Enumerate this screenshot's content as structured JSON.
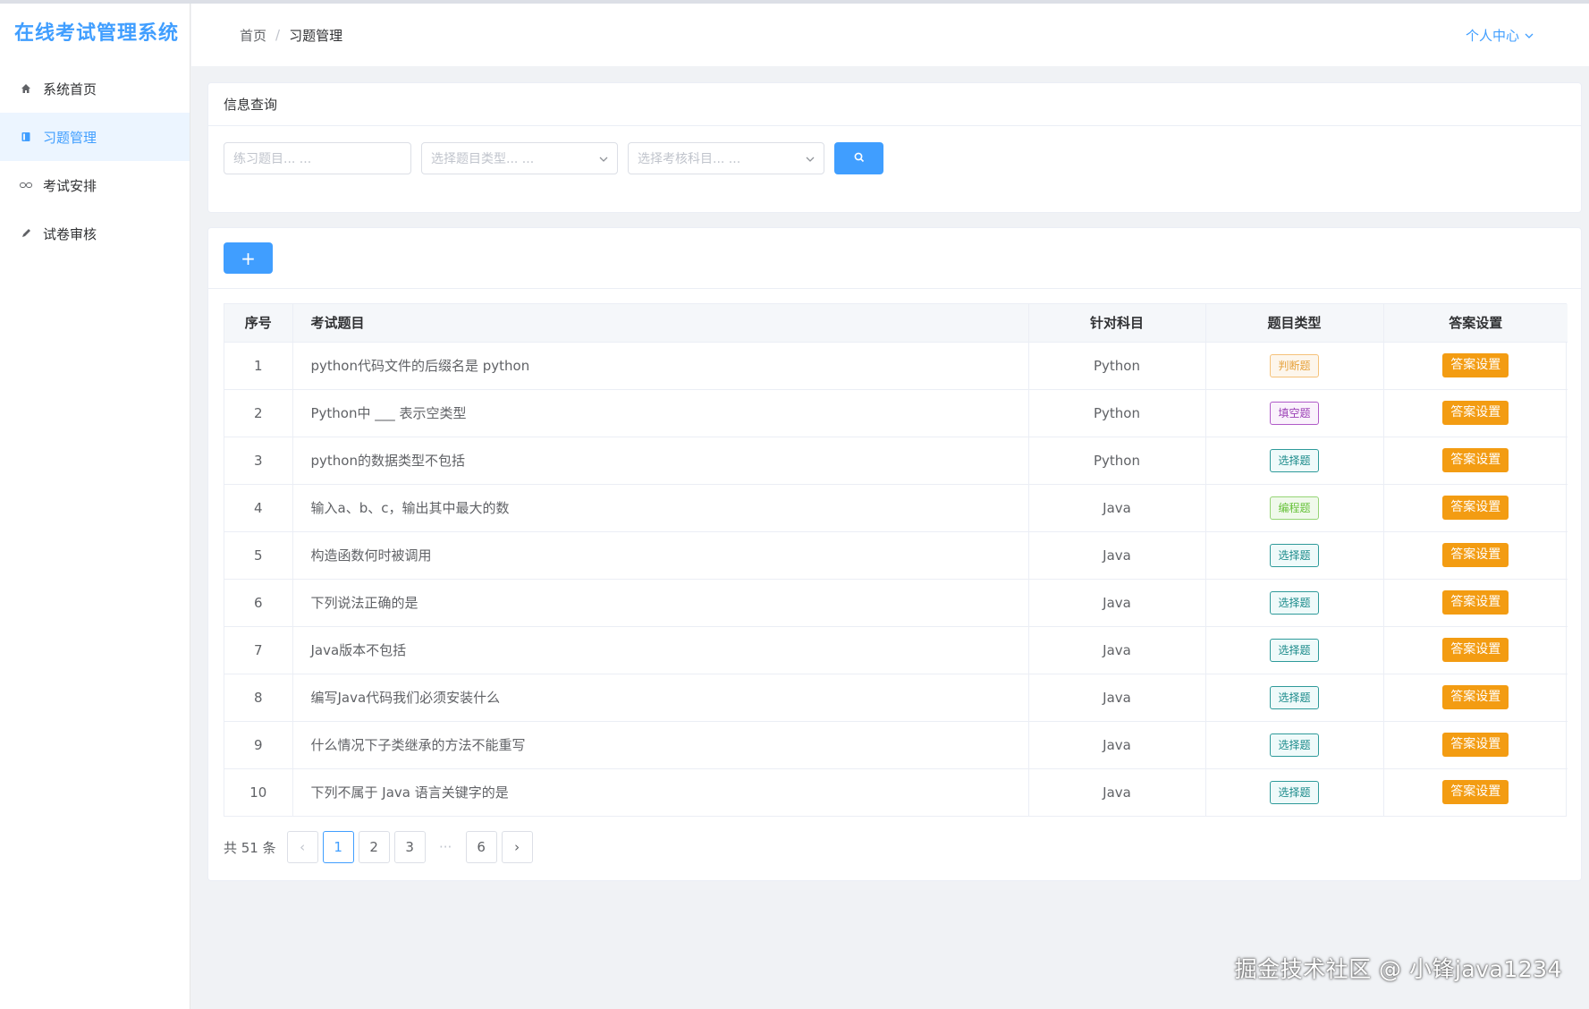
{
  "app": {
    "title": "在线考试管理系统"
  },
  "sidebar": {
    "items": [
      {
        "label": "系统首页",
        "icon": "home-icon"
      },
      {
        "label": "习题管理",
        "icon": "book-icon",
        "active": true
      },
      {
        "label": "考试安排",
        "icon": "link-icon"
      },
      {
        "label": "试卷审核",
        "icon": "pencil-icon"
      }
    ]
  },
  "header": {
    "breadcrumb": {
      "home": "首页",
      "separator": "/",
      "current": "习题管理"
    },
    "user_center": "个人中心"
  },
  "query": {
    "title": "信息查询",
    "question_placeholder": "练习题目... ...",
    "type_placeholder": "选择题目类型... ...",
    "subject_placeholder": "选择考核科目... ..."
  },
  "list": {
    "add_label": "+",
    "columns": [
      "序号",
      "考试题目",
      "针对科目",
      "题目类型",
      "答案设置"
    ],
    "rows": [
      {
        "no": "1",
        "question": "python代码文件的后缀名是 python",
        "subject": "Python",
        "type": "判断题",
        "kind": "judge",
        "action": "答案设置"
      },
      {
        "no": "2",
        "question": "Python中 ___ 表示空类型",
        "subject": "Python",
        "type": "填空题",
        "kind": "fill",
        "action": "答案设置"
      },
      {
        "no": "3",
        "question": "python的数据类型不包括",
        "subject": "Python",
        "type": "选择题",
        "kind": "choice",
        "action": "答案设置"
      },
      {
        "no": "4",
        "question": "输入a、b、c，输出其中最大的数",
        "subject": "Java",
        "type": "编程题",
        "kind": "code",
        "action": "答案设置"
      },
      {
        "no": "5",
        "question": "构造函数何时被调用",
        "subject": "Java",
        "type": "选择题",
        "kind": "choice",
        "action": "答案设置"
      },
      {
        "no": "6",
        "question": "下列说法正确的是",
        "subject": "Java",
        "type": "选择题",
        "kind": "choice",
        "action": "答案设置"
      },
      {
        "no": "7",
        "question": "Java版本不包括",
        "subject": "Java",
        "type": "选择题",
        "kind": "choice",
        "action": "答案设置"
      },
      {
        "no": "8",
        "question": "编写Java代码我们必须安装什么",
        "subject": "Java",
        "type": "选择题",
        "kind": "choice",
        "action": "答案设置"
      },
      {
        "no": "9",
        "question": "什么情况下子类继承的方法不能重写",
        "subject": "Java",
        "type": "选择题",
        "kind": "choice",
        "action": "答案设置"
      },
      {
        "no": "10",
        "question": "下列不属于 Java 语言关键字的是",
        "subject": "Java",
        "type": "选择题",
        "kind": "choice",
        "action": "答案设置"
      }
    ]
  },
  "pagination": {
    "total": "共 51 条",
    "prev": "‹",
    "next": "›",
    "pages": [
      "1",
      "2",
      "3"
    ],
    "ellipsis": "···",
    "last": "6",
    "current": "1"
  },
  "watermark": "掘金技术社区 @ 小锋java1234"
}
